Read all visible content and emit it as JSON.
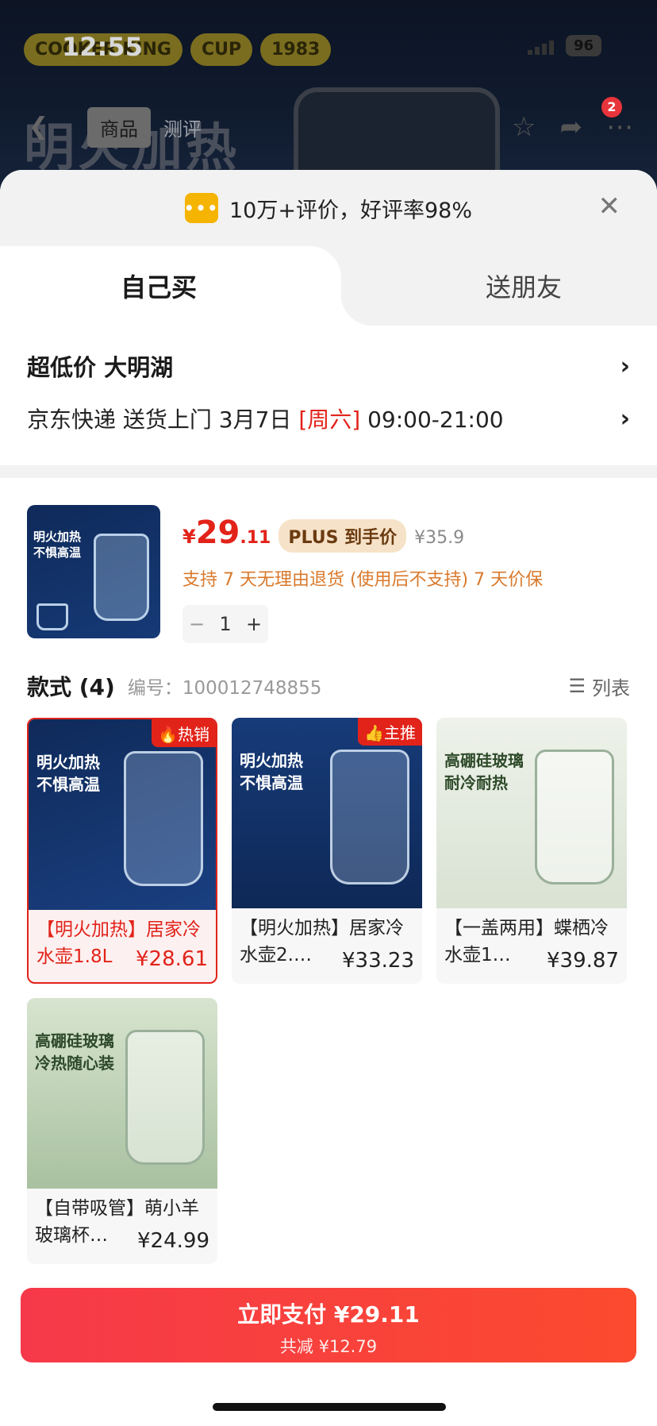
{
  "status_bar": {
    "time": "12:55",
    "battery": "96"
  },
  "backdrop": {
    "brand": [
      "COOKER KING",
      "CUP",
      "1983"
    ],
    "headline": "明火加热"
  },
  "nav": {
    "tabs": [
      "商品",
      "测评"
    ],
    "cart_badge": "2"
  },
  "review": {
    "text": "10万+评价，好评率98%"
  },
  "purchase_tabs": {
    "self": "自己买",
    "friend": "送朋友"
  },
  "delivery": {
    "title": "超低价  大明湖",
    "line_prefix": "京东快递 送货上门 3月7日 ",
    "weekday": "[周六]",
    "time_range": " 09:00-21:00"
  },
  "product": {
    "price_currency": "¥",
    "price_int": "29",
    "price_dec": ".11",
    "plus_tag": "PLUS 到手价",
    "original_price": "¥35.9",
    "policy": "支持 7 天无理由退货 (使用后不支持)   7 天价保",
    "quantity": "1",
    "thumb_text": "明火加热\n不惧高温"
  },
  "styles": {
    "title": "款式 (4)",
    "code_label": "编号：",
    "code": "100012748855",
    "view_toggle": "列表",
    "items": [
      {
        "name": "【明火加热】居家冷水壶1.8L",
        "price": "¥28.61",
        "tag": "热销",
        "img_text": "明火加热\n不惧高温"
      },
      {
        "name": "【明火加热】居家冷水壶2.…",
        "price": "¥33.23",
        "tag": "主推",
        "img_text": "明火加热\n不惧高温"
      },
      {
        "name": "【一盖两用】蝶栖冷水壶1…",
        "price": "¥39.87",
        "tag": "",
        "img_text": "高硼硅玻璃\n耐冷耐热"
      },
      {
        "name": "【自带吸管】萌小羊玻璃杯…",
        "price": "¥24.99",
        "tag": "",
        "img_text": "高硼硅玻璃\n冷热随心装"
      }
    ]
  },
  "pay": {
    "label": "立即支付 ¥29.11",
    "discount": "共减 ¥12.79"
  },
  "colors": {
    "accent": "#e2231a",
    "pay_button": "#f6394a",
    "plus_bg": "#f6e2c8"
  }
}
